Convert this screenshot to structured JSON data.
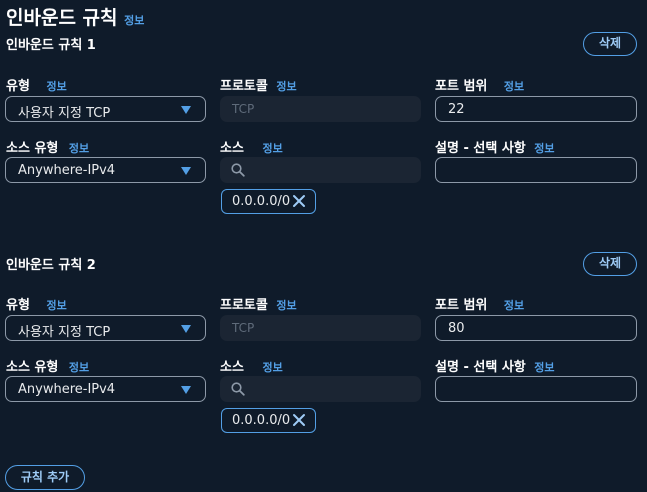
{
  "section": {
    "title": "인바운드 규칙",
    "info": "정보"
  },
  "rules": [
    {
      "title": "인바운드 규칙 1",
      "delete_label": "삭제",
      "type_label": "유형",
      "type_info": "정보",
      "type_value": "사용자 지정 TCP",
      "protocol_label": "프로토콜",
      "protocol_info": "정보",
      "protocol_value": "TCP",
      "port_label": "포트 범위",
      "port_info": "정보",
      "port_value": "22",
      "source_type_label": "소스 유형",
      "source_type_info": "정보",
      "source_type_value": "Anywhere-IPv4",
      "source_label": "소스",
      "source_info": "정보",
      "source_search_value": "",
      "source_token": "0.0.0.0/0",
      "desc_label": "설명 - 선택 사항",
      "desc_info": "정보",
      "desc_value": ""
    },
    {
      "title": "인바운드 규칙 2",
      "delete_label": "삭제",
      "type_label": "유형",
      "type_info": "정보",
      "type_value": "사용자 지정 TCP",
      "protocol_label": "프로토콜",
      "protocol_info": "정보",
      "protocol_value": "TCP",
      "port_label": "포트 범위",
      "port_info": "정보",
      "port_value": "80",
      "source_type_label": "소스 유형",
      "source_type_info": "정보",
      "source_type_value": "Anywhere-IPv4",
      "source_label": "소스",
      "source_info": "정보",
      "source_search_value": "",
      "source_token": "0.0.0.0/0",
      "desc_label": "설명 - 선택 사항",
      "desc_info": "정보",
      "desc_value": ""
    }
  ],
  "add_rule_label": "규칙 추가",
  "colors": {
    "background": "#0f1b2a",
    "accent": "#539fe5",
    "border": "#8d99a8",
    "disabled_bg": "#1b2533"
  }
}
